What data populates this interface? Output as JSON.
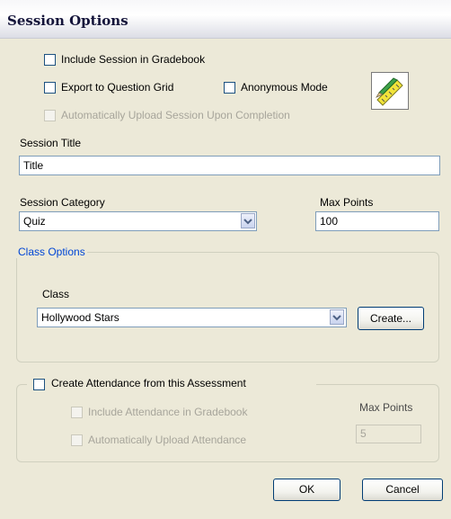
{
  "window": {
    "title": "Session Options"
  },
  "options": {
    "include_gradebook": "Include Session in Gradebook",
    "export_grid": "Export to Question Grid",
    "anonymous_mode": "Anonymous Mode",
    "auto_upload": "Automatically Upload Session Upon Completion",
    "icon": "ruler-pencil-icon"
  },
  "session": {
    "title_label": "Session Title",
    "title_value": "Title",
    "category_label": "Session Category",
    "category_value": "Quiz",
    "max_points_label": "Max Points",
    "max_points_value": "100"
  },
  "class_options": {
    "legend": "Class Options",
    "class_label": "Class",
    "class_value": "Hollywood Stars",
    "create_button": "Create..."
  },
  "attendance": {
    "create_label": "Create Attendance from this Assessment",
    "include_gradebook": "Include Attendance in Gradebook",
    "auto_upload": "Automatically Upload Attendance",
    "max_points_label": "Max Points",
    "max_points_value": "5"
  },
  "buttons": {
    "ok": "OK",
    "cancel": "Cancel"
  },
  "colors": {
    "link_legend": "#0046d5",
    "title_text": "#14143a"
  }
}
